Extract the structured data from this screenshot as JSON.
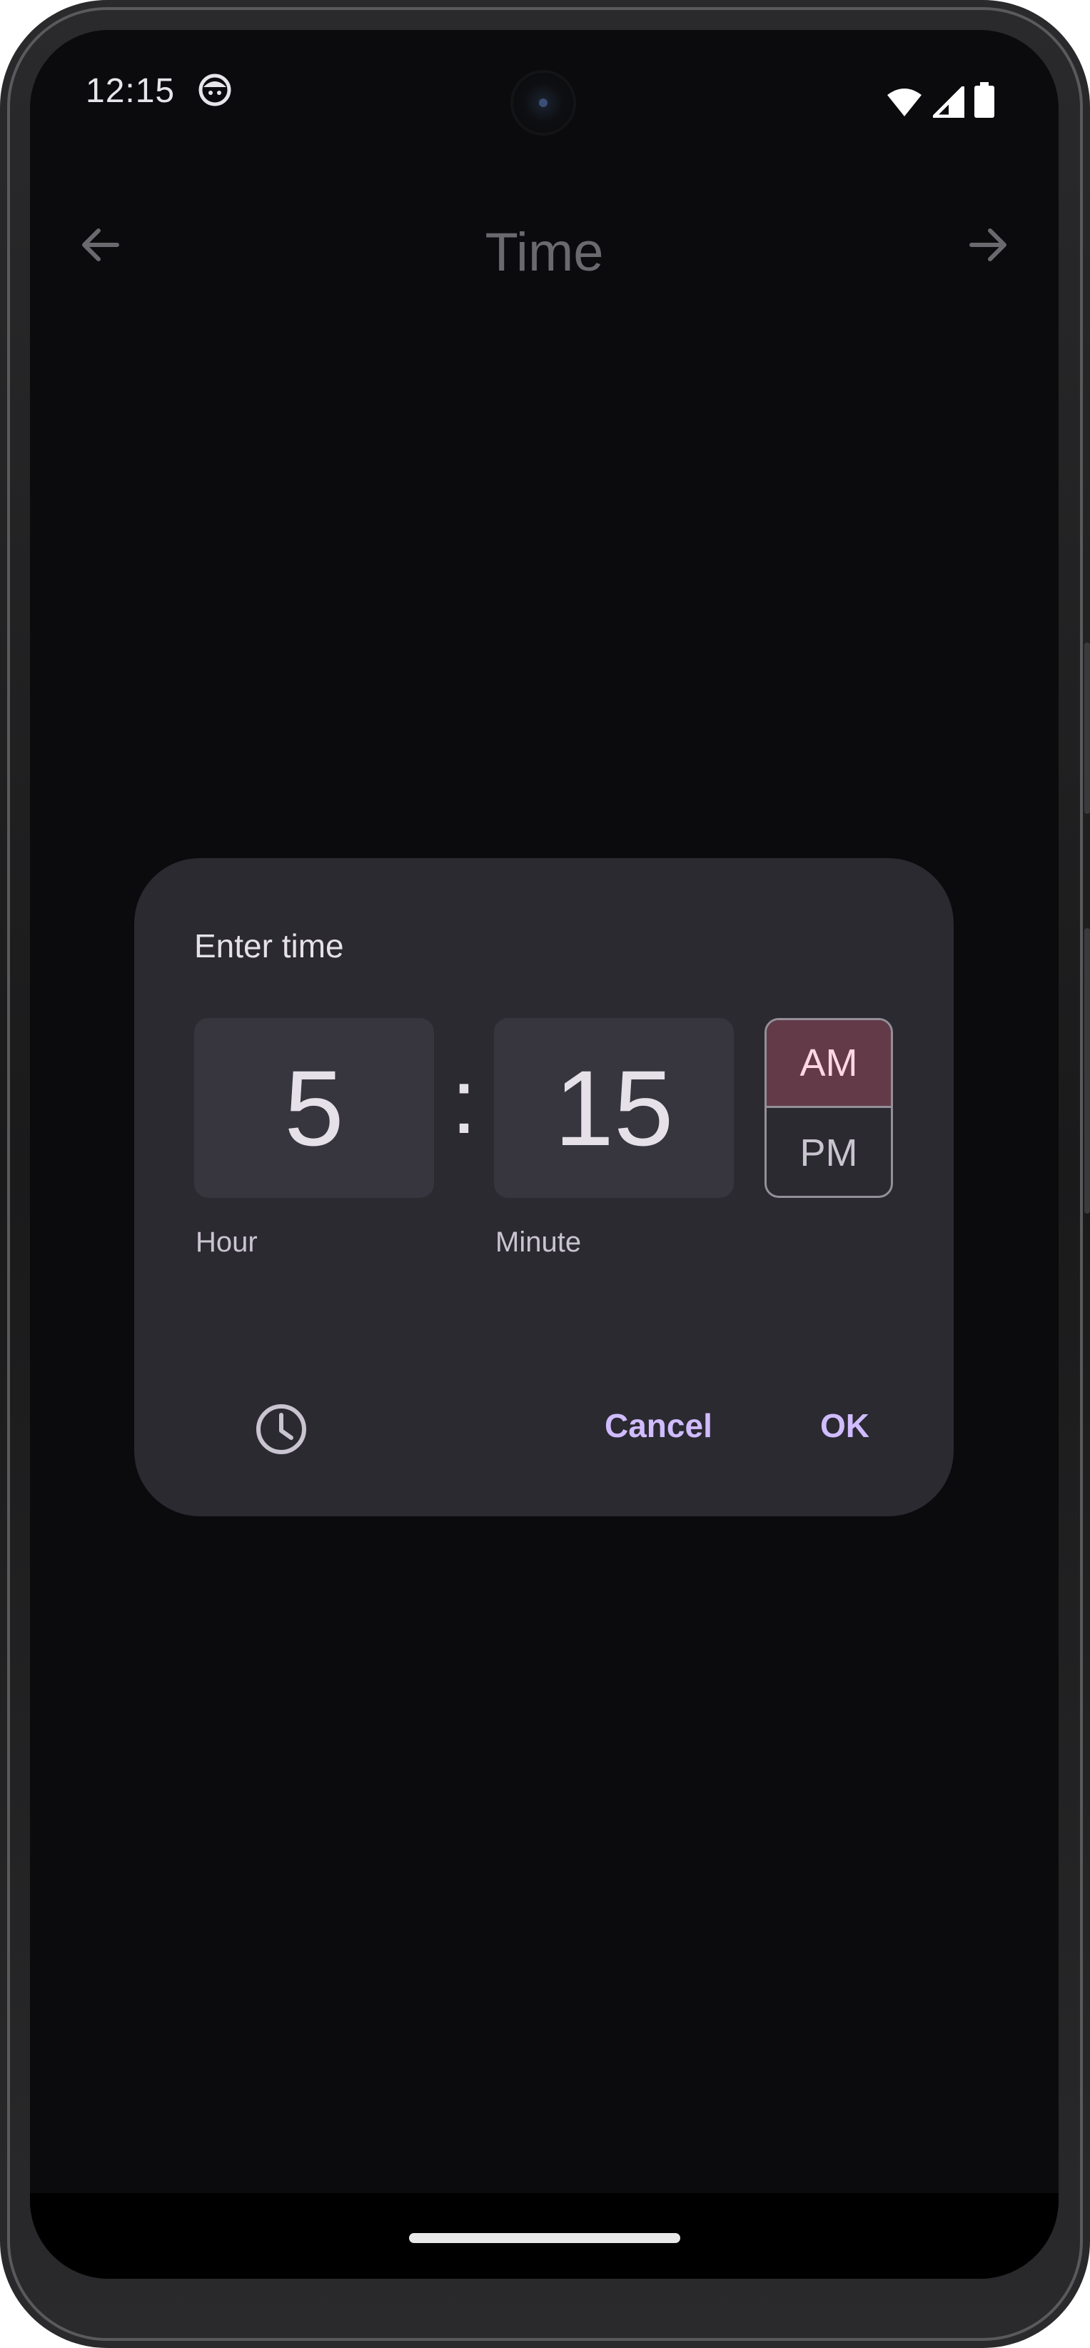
{
  "status_bar": {
    "time": "12:15",
    "icons": [
      "app-notification-icon",
      "wifi-icon",
      "signal-icon",
      "battery-icon"
    ]
  },
  "app_bar": {
    "title": "Time",
    "back_icon": "arrow-back-icon",
    "forward_icon": "arrow-forward-icon"
  },
  "dialog": {
    "title": "Enter time",
    "hour_value": "5",
    "minute_value": "15",
    "separator": ":",
    "hour_label": "Hour",
    "minute_label": "Minute",
    "period": {
      "am_label": "AM",
      "pm_label": "PM",
      "selected": "AM"
    },
    "mode_toggle_icon": "clock-icon",
    "cancel_label": "Cancel",
    "ok_label": "OK"
  },
  "colors": {
    "screen_bg": "#0b0b0d",
    "dialog_bg": "#2b2a31",
    "field_bg": "#37363e",
    "selected_period_bg": "#633b48",
    "selected_period_text": "#ffd8e4",
    "accent_text": "#d0bcff",
    "app_title": "#6a6a6e"
  }
}
